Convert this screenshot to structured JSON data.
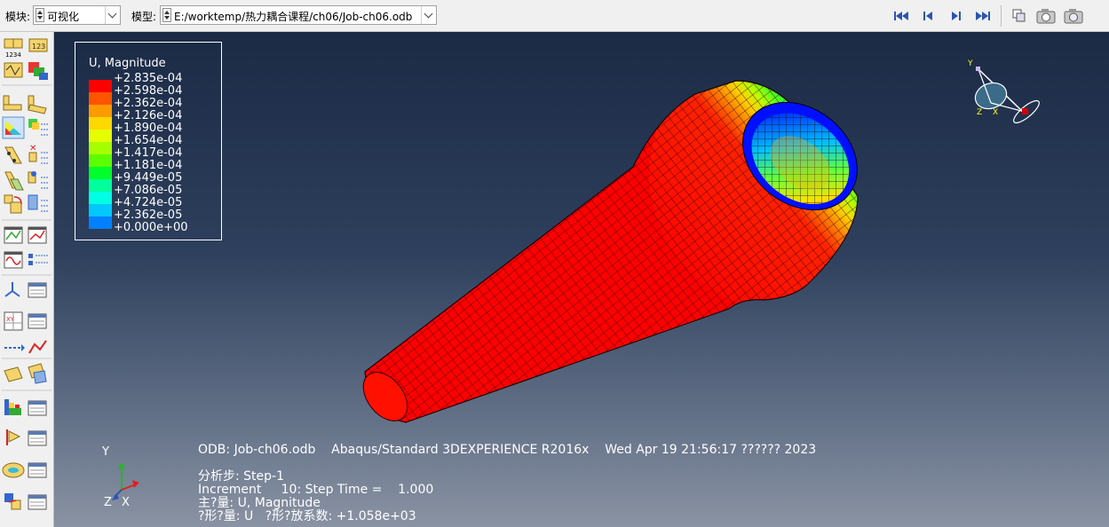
{
  "toolbar": {
    "module_label": "模块:",
    "module_value": "可视化",
    "model_label": "模型:",
    "model_value": "E:/worktemp/热力耦合课程/ch06/Job-ch06.odb",
    "nav_icons": [
      "first-frame-icon",
      "previous-frame-icon",
      "next-frame-icon",
      "last-frame-icon"
    ],
    "view_icons": [
      "view-manager-icon",
      "camera-icon",
      "camera-alt-icon"
    ]
  },
  "legend": {
    "title": "U, Magnitude",
    "colors": [
      "#ff0000",
      "#ff5400",
      "#ff9a00",
      "#ffd800",
      "#e6ff00",
      "#a6ff00",
      "#5cff00",
      "#00ff2a",
      "#00ff9c",
      "#00ffe4",
      "#00c8ff",
      "#0080ff",
      "#0000ff"
    ],
    "values": [
      "+2.835e-04",
      "+2.598e-04",
      "+2.362e-04",
      "+2.126e-04",
      "+1.890e-04",
      "+1.654e-04",
      "+1.417e-04",
      "+1.181e-04",
      "+9.449e-05",
      "+7.086e-05",
      "+4.724e-05",
      "+2.362e-05",
      "+0.000e+00"
    ]
  },
  "info": {
    "line1": "ODB: Job-ch06.odb    Abaqus/Standard 3DEXPERIENCE R2016x    Wed Apr 19 21:56:17 ?????? 2023",
    "line2": "分析步: Step-1",
    "line3": "Increment     10: Step Time =    1.000",
    "line4": "主?量: U, Magnitude",
    "line5": "?形?量: U   ?形?放系数: +1.058e+03"
  },
  "triad": {
    "y": "Y",
    "z": "Z",
    "x": "X"
  },
  "compass": {
    "y": "Y",
    "z": "Z",
    "x": "X"
  },
  "tools": [
    "plot-undeformed-icon",
    "plot-contours-icon",
    "deformed-shape-icon",
    "symbol-plot-icon",
    "material-orientation-icon",
    "animate-icon",
    "xy-data-icon",
    "path-icon",
    "display-group-icon",
    "color-code-icon",
    "view-cut-icon",
    "query-icon",
    "options-icon"
  ]
}
